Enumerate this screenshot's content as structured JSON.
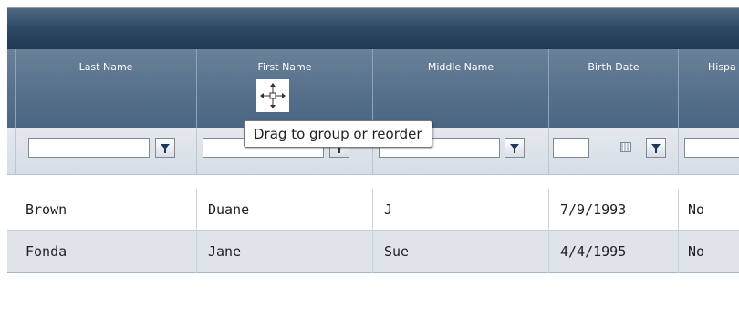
{
  "columns": [
    {
      "label": "Last Name"
    },
    {
      "label": "First Name"
    },
    {
      "label": "Middle Name"
    },
    {
      "label": "Birth Date"
    },
    {
      "label": "Hispa"
    }
  ],
  "rows": [
    {
      "last": "Brown",
      "first": "Duane",
      "middle": "J",
      "birth": "7/9/1993",
      "hispanic": "No"
    },
    {
      "last": "Fonda",
      "first": "Jane",
      "middle": "Sue",
      "birth": "4/4/1995",
      "hispanic": "No"
    }
  ],
  "tooltip": {
    "text": "Drag to group or reorder"
  },
  "icons": {
    "filter": "filter-funnel-icon",
    "calendar": "calendar-icon",
    "drag": "move-cursor-icon"
  }
}
